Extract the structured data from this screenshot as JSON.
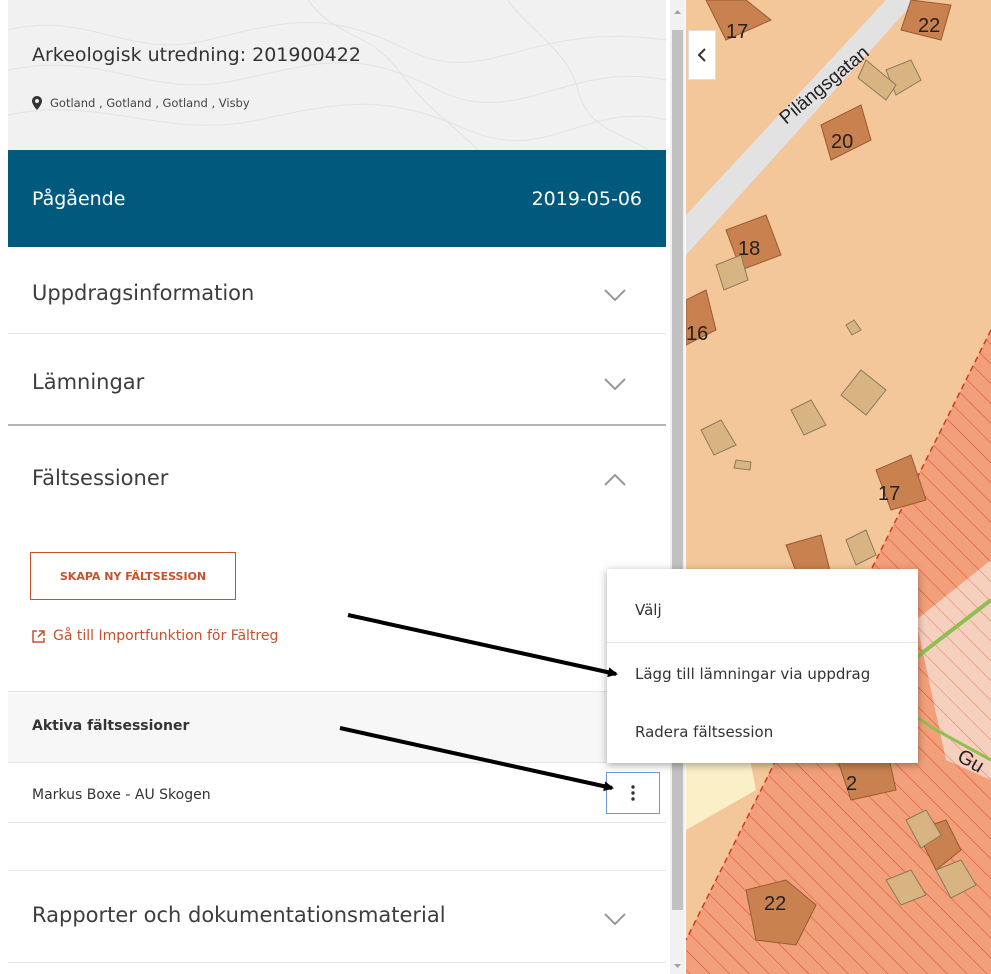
{
  "header": {
    "title": "Arkeologisk utredning: 201900422",
    "location": "Gotland , Gotland , Gotland , Visby",
    "location_icon": "map-marker-icon"
  },
  "status": {
    "label": "Pågående",
    "date": "2019-05-06"
  },
  "sections": {
    "uppdrag": "Uppdragsinformation",
    "lamningar": "Lämningar",
    "faltsessioner": "Fältsessioner",
    "rapporter": "Rapporter och dokumentationsmaterial"
  },
  "faltsessioner": {
    "create_button": "SKAPA NY FÄLTSESSION",
    "import_link": "Gå till Importfunktion för Fältreg",
    "active_header": "Aktiva fältsessioner",
    "sessions": [
      {
        "name": "Markus Boxe - AU Skogen"
      }
    ]
  },
  "context_menu": {
    "items": [
      "Välj",
      "Lägg till lämningar via uppdrag",
      "Radera fältsession"
    ]
  },
  "map": {
    "street_1": "Pilängsgatan",
    "street_2": "Gu",
    "numbers": [
      "17",
      "22",
      "20",
      "18",
      "16",
      "17",
      "2",
      "22"
    ]
  },
  "colors": {
    "status_bg": "#005a7e",
    "accent": "#c8502a",
    "map_land": "#f3c79a",
    "map_building": "#c8814f",
    "map_hatch": "#e05a3a"
  }
}
